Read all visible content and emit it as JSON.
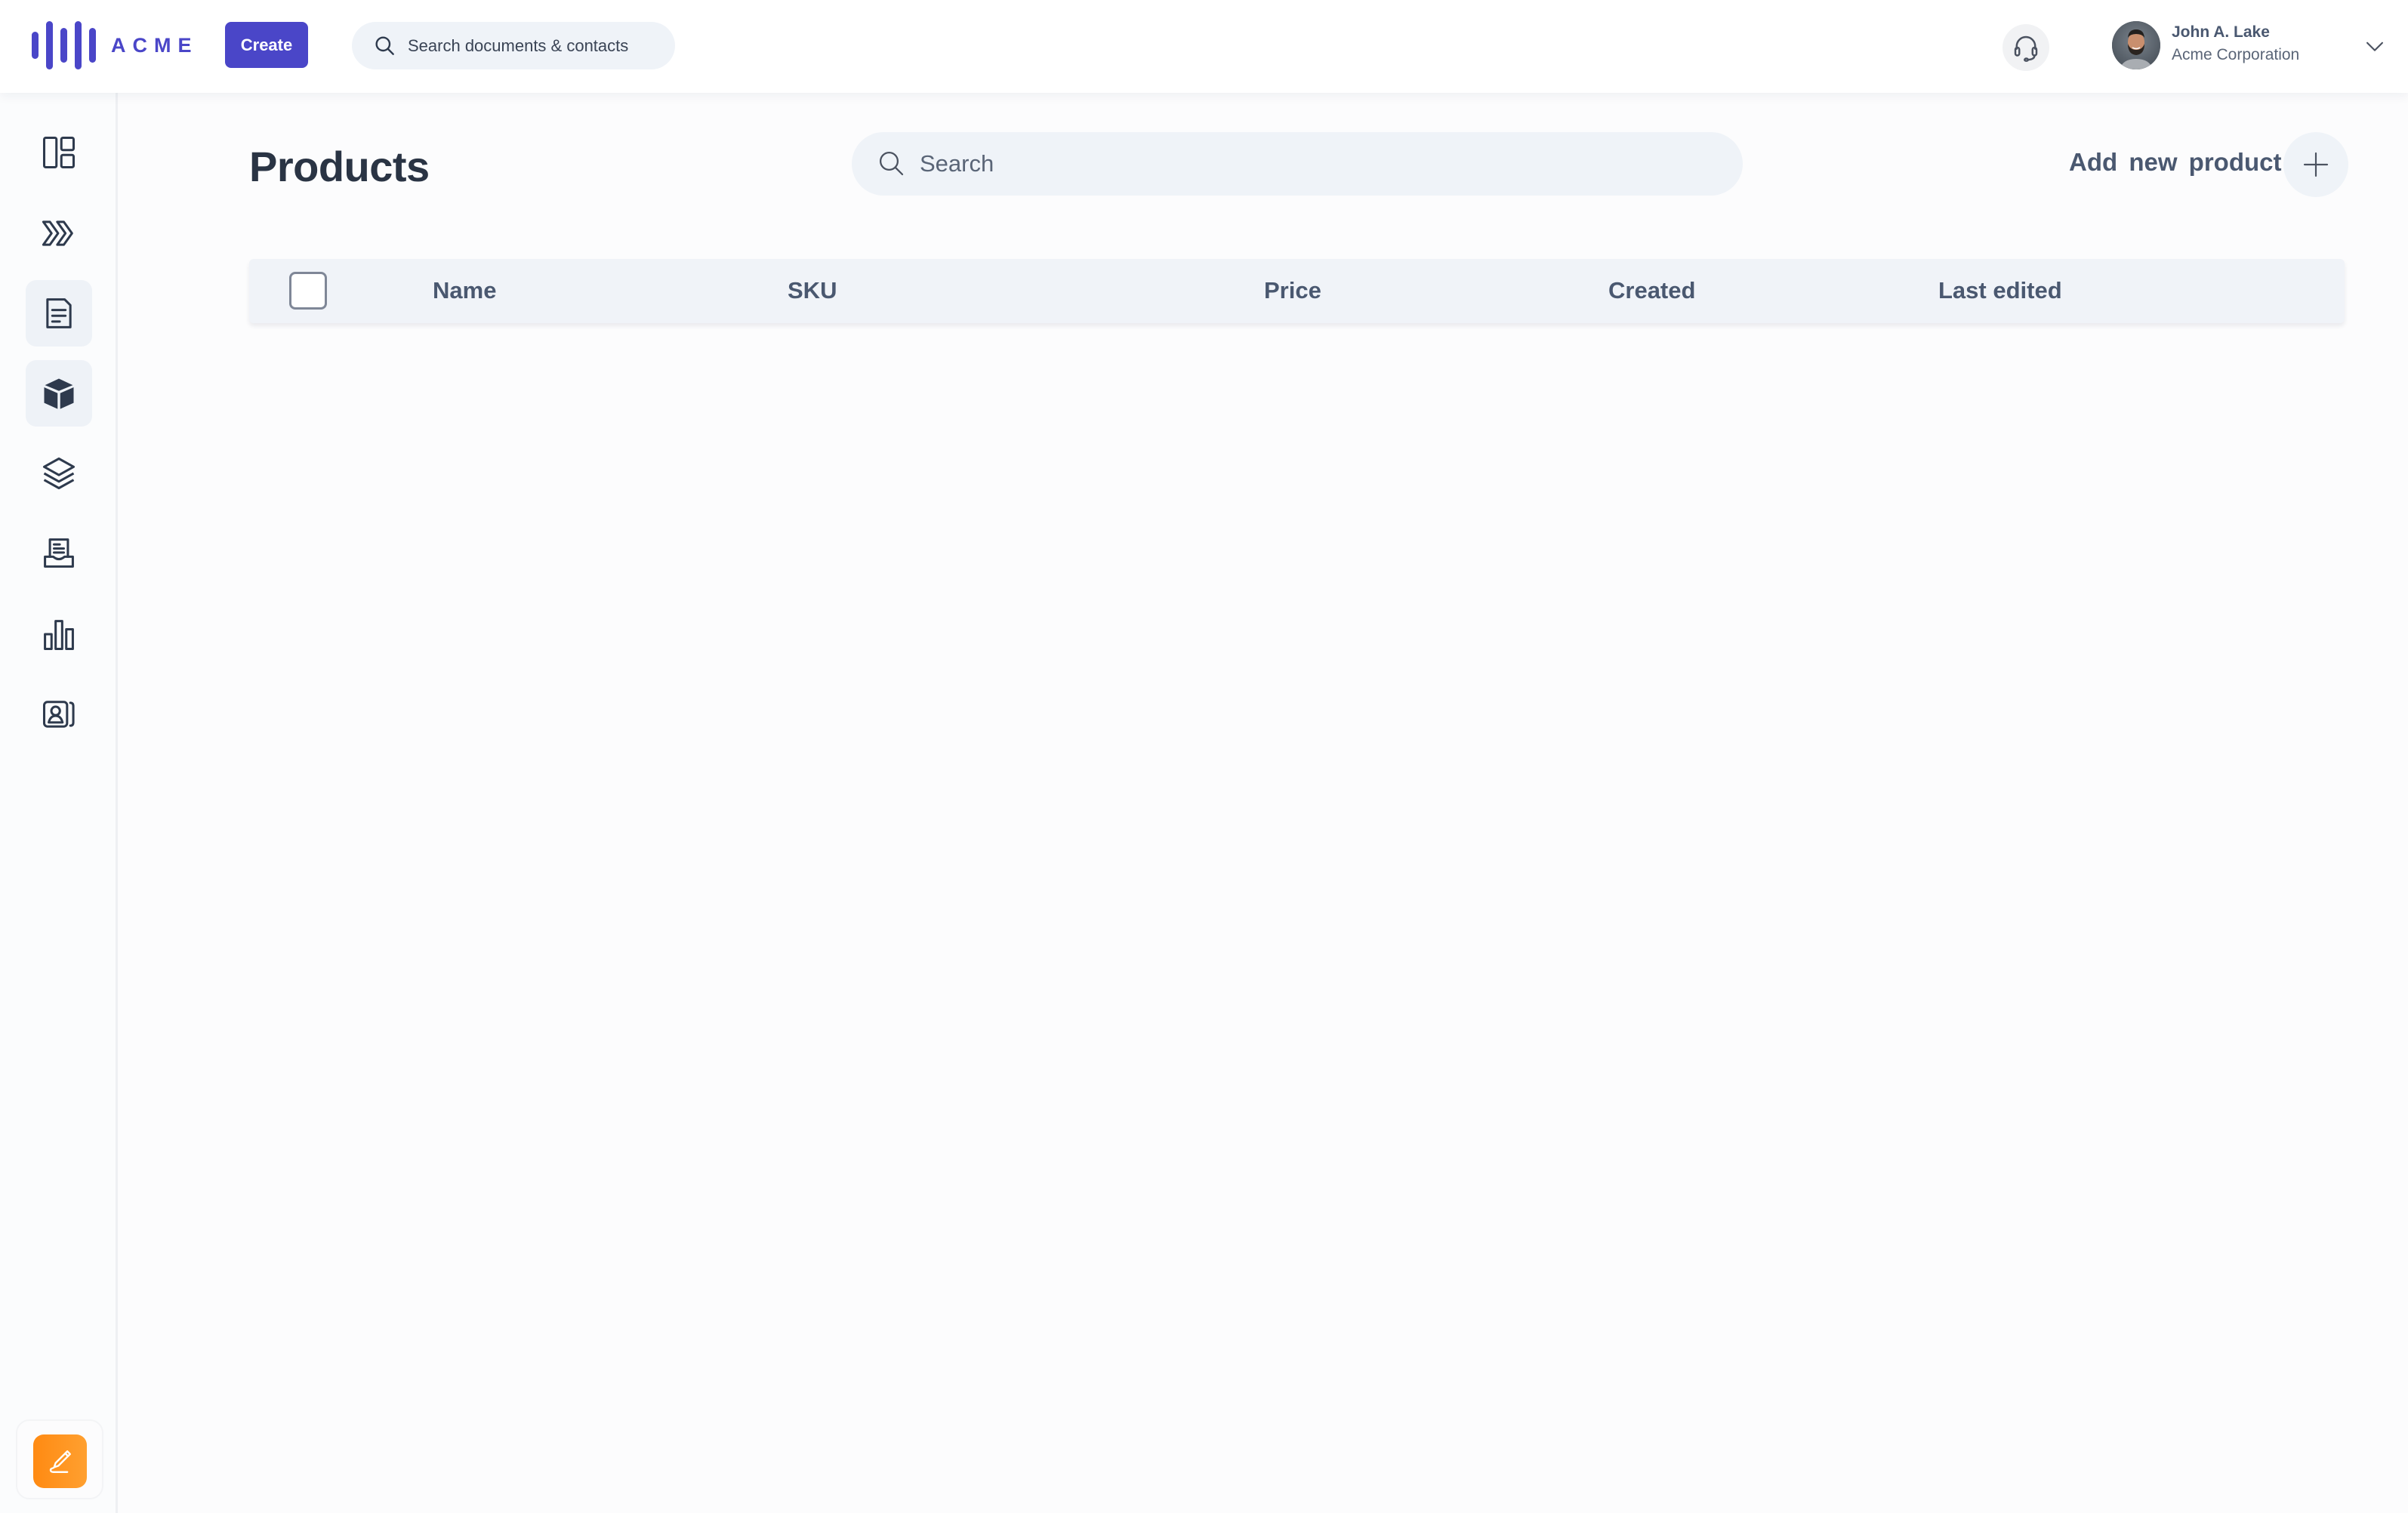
{
  "app": {
    "brand": "ACME",
    "colors": {
      "brand": "#4a46c8",
      "accent_orange": "#ff8a12",
      "text_dark": "#2a3444",
      "text_muted": "#4a5870",
      "surface": "#eff3f8"
    }
  },
  "topbar": {
    "create_label": "Create",
    "search_placeholder": "Search documents & contacts",
    "search_icon": "search-icon",
    "support_icon": "headset-icon",
    "user": {
      "name": "John A. Lake",
      "organization": "Acme Corporation",
      "menu_icon": "chevron-down-icon"
    }
  },
  "sidebar": {
    "items": [
      {
        "icon": "dashboard-icon",
        "active": false
      },
      {
        "icon": "double-chevron-right-icon",
        "active": false
      },
      {
        "icon": "document-icon",
        "active": true
      },
      {
        "icon": "cube-icon",
        "active": true
      },
      {
        "icon": "layers-icon",
        "active": false
      },
      {
        "icon": "inbox-document-icon",
        "active": false
      },
      {
        "icon": "bar-chart-icon",
        "active": false
      },
      {
        "icon": "contacts-icon",
        "active": false
      }
    ],
    "compose_icon": "pencil-signature-icon"
  },
  "main": {
    "title": "Products",
    "search_placeholder": "Search",
    "search_value": "",
    "add_label": "Add new  product",
    "table": {
      "select_all_checked": false,
      "columns": [
        "Name",
        "SKU",
        "Price",
        "Created",
        "Last edited"
      ],
      "rows": []
    }
  }
}
